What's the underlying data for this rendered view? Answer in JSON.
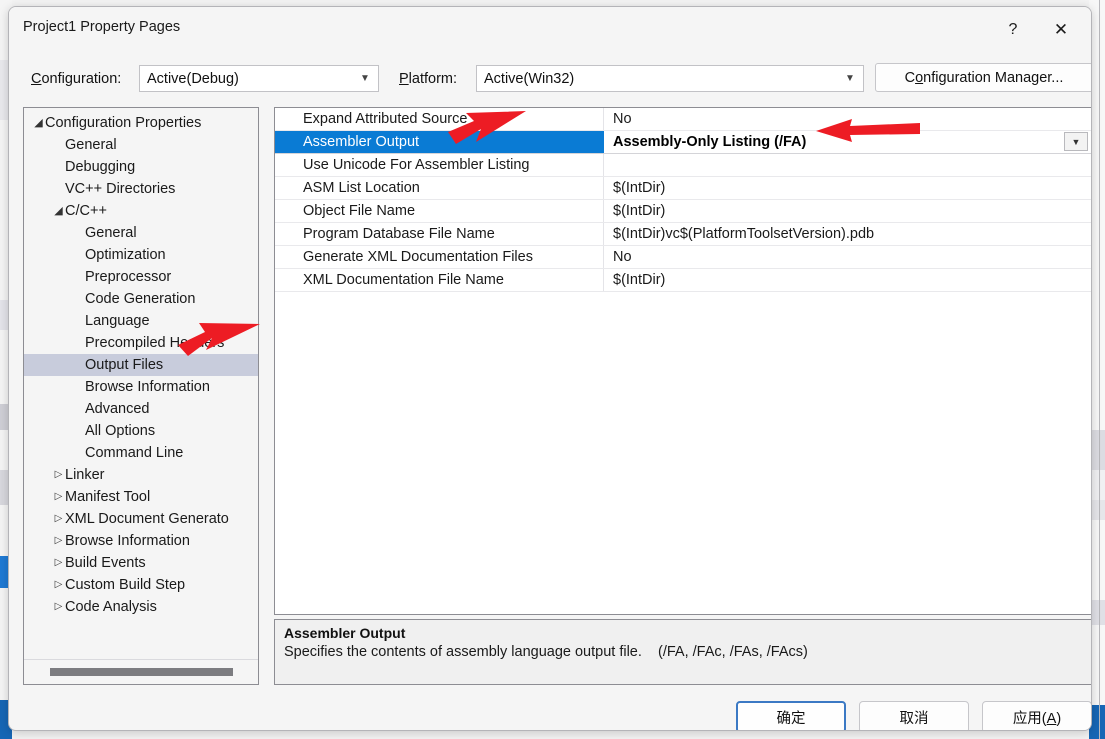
{
  "window": {
    "title": "Project1 Property Pages",
    "help_icon": "question-mark-icon",
    "close_icon": "close-icon"
  },
  "config_bar": {
    "configuration_label": "Configuration:",
    "configuration_accel": "C",
    "configuration_value": "Active(Debug)",
    "platform_label": "Platform:",
    "platform_accel": "P",
    "platform_value": "Active(Win32)",
    "config_manager_label": "Configuration Manager...",
    "config_manager_accel": "o",
    "chevron_icon": "chevron-down-icon"
  },
  "tree": {
    "items": [
      {
        "label": "Configuration Properties",
        "indent": 0,
        "twisty": "expanded",
        "selected": false
      },
      {
        "label": "General",
        "indent": 1,
        "twisty": "none",
        "selected": false
      },
      {
        "label": "Debugging",
        "indent": 1,
        "twisty": "none",
        "selected": false
      },
      {
        "label": "VC++ Directories",
        "indent": 1,
        "twisty": "none",
        "selected": false
      },
      {
        "label": "C/C++",
        "indent": 1,
        "twisty": "expanded",
        "selected": false
      },
      {
        "label": "General",
        "indent": 2,
        "twisty": "none",
        "selected": false
      },
      {
        "label": "Optimization",
        "indent": 2,
        "twisty": "none",
        "selected": false
      },
      {
        "label": "Preprocessor",
        "indent": 2,
        "twisty": "none",
        "selected": false
      },
      {
        "label": "Code Generation",
        "indent": 2,
        "twisty": "none",
        "selected": false
      },
      {
        "label": "Language",
        "indent": 2,
        "twisty": "none",
        "selected": false
      },
      {
        "label": "Precompiled Headers",
        "indent": 2,
        "twisty": "none",
        "selected": false
      },
      {
        "label": "Output Files",
        "indent": 2,
        "twisty": "none",
        "selected": true
      },
      {
        "label": "Browse Information",
        "indent": 2,
        "twisty": "none",
        "selected": false
      },
      {
        "label": "Advanced",
        "indent": 2,
        "twisty": "none",
        "selected": false
      },
      {
        "label": "All Options",
        "indent": 2,
        "twisty": "none",
        "selected": false
      },
      {
        "label": "Command Line",
        "indent": 2,
        "twisty": "none",
        "selected": false
      },
      {
        "label": "Linker",
        "indent": 1,
        "twisty": "collapsed",
        "selected": false
      },
      {
        "label": "Manifest Tool",
        "indent": 1,
        "twisty": "collapsed",
        "selected": false
      },
      {
        "label": "XML Document Generato",
        "indent": 1,
        "twisty": "collapsed",
        "selected": false
      },
      {
        "label": "Browse Information",
        "indent": 1,
        "twisty": "collapsed",
        "selected": false
      },
      {
        "label": "Build Events",
        "indent": 1,
        "twisty": "collapsed",
        "selected": false
      },
      {
        "label": "Custom Build Step",
        "indent": 1,
        "twisty": "collapsed",
        "selected": false
      },
      {
        "label": "Code Analysis",
        "indent": 1,
        "twisty": "collapsed",
        "selected": false
      }
    ],
    "scrollbar": "horizontal-scrollbar"
  },
  "grid": {
    "rows": [
      {
        "name": "Expand Attributed Source",
        "value": "No",
        "selected": false,
        "has_dropdown": false
      },
      {
        "name": "Assembler Output",
        "value": "Assembly-Only Listing (/FA)",
        "selected": true,
        "has_dropdown": true
      },
      {
        "name": "Use Unicode For Assembler Listing",
        "value": "",
        "selected": false,
        "has_dropdown": false
      },
      {
        "name": "ASM List Location",
        "value": "$(IntDir)",
        "selected": false,
        "has_dropdown": false
      },
      {
        "name": "Object File Name",
        "value": "$(IntDir)",
        "selected": false,
        "has_dropdown": false
      },
      {
        "name": "Program Database File Name",
        "value": "$(IntDir)vc$(PlatformToolsetVersion).pdb",
        "selected": false,
        "has_dropdown": false
      },
      {
        "name": "Generate XML Documentation Files",
        "value": "No",
        "selected": false,
        "has_dropdown": false
      },
      {
        "name": "XML Documentation File Name",
        "value": "$(IntDir)",
        "selected": false,
        "has_dropdown": false
      }
    ]
  },
  "description": {
    "title": "Assembler Output",
    "body": "Specifies the contents of assembly language output file.    (/FA, /FAc, /FAs, /FAcs)"
  },
  "footer": {
    "ok_label": "确定",
    "cancel_label": "取消",
    "apply_label": "应用(A)",
    "apply_accel": "A"
  },
  "annotations": {
    "arrow_color": "#ED1C24",
    "arrows": [
      {
        "name": "arrow-pointing-to-output-files",
        "target": "Output Files"
      },
      {
        "name": "arrow-pointing-to-assembler-output-row",
        "target": "Assembler Output"
      },
      {
        "name": "arrow-pointing-to-assembler-output-value",
        "target": "Assembly-Only Listing (/FA)"
      }
    ]
  },
  "colors": {
    "selection_blue": "#0A7BD4",
    "tree_selection": "#C8CCDC",
    "dialog_bg": "#F5F5F5",
    "default_button_border": "#3B79C4"
  }
}
